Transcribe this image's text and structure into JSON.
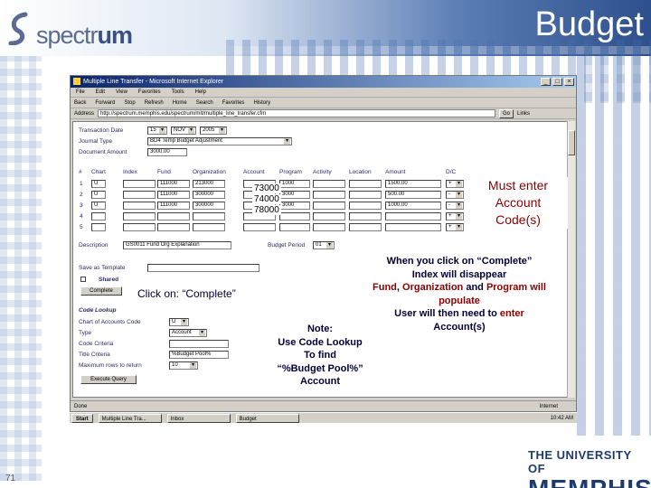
{
  "slide": {
    "title": "Budget",
    "logo": "spectrum",
    "logo_prefix": "spectr",
    "logo_suffix": "um",
    "number": "71",
    "university_top": "THE UNIVERSITY OF",
    "university_name": "MEMPHIS"
  },
  "browser": {
    "title": "Multiple Line Transfer - Microsoft Internet Explorer",
    "menu": [
      "File",
      "Edit",
      "View",
      "Favorites",
      "Tools",
      "Help"
    ],
    "toolbar": [
      "Back",
      "Forward",
      "Stop",
      "Refresh",
      "Home",
      "Search",
      "Favorites",
      "History"
    ],
    "address_label": "Address",
    "address_value": "http://spectrum.memphis.edu/spectrum/mlt/multiple_line_transfer.cfm",
    "go_label": "Go",
    "links_label": "Links",
    "status_text": "Done",
    "zone_text": "Internet",
    "start_label": "Start",
    "tasks": [
      "Multiple Line Tra...",
      "Inbox",
      "Budget"
    ],
    "clock": "10:42 AM"
  },
  "form": {
    "labels": {
      "transaction_date": "Transaction Date",
      "journal_type": "Journal Type",
      "document_amount": "Document Amount",
      "description": "Description",
      "budget_period": "Budget Period",
      "save_as_template": "Save as Template",
      "shared": "Shared",
      "complete": "Complete",
      "code_lookup": "Code Lookup",
      "chart_of_accounts_code": "Chart of Accounts Code",
      "type": "Type",
      "code_criteria": "Code Criteria",
      "title_criteria": "Title Criteria",
      "max_rows": "Maximum rows to return",
      "execute_query": "Execute Query"
    },
    "values": {
      "date_day": "15",
      "date_month": "NOV",
      "date_year": "2005",
      "journal_type": "BD4 Temp Budget Adjustment",
      "document_amount": "3000.00",
      "description": "GS0011 Fund Org Explanation",
      "budget_period": "01",
      "chart_code": "U",
      "lookup_type": "Account",
      "title_criteria": "%Budget Pool%",
      "max_rows": "10"
    },
    "grid": {
      "headers": [
        "#",
        "Chart",
        "Index",
        "Fund",
        "Organization",
        "Account",
        "Program",
        "Activity",
        "Location",
        "Amount",
        "D/C"
      ],
      "rows": [
        {
          "num": "1",
          "chart": "U",
          "fund": "111000",
          "org": "213000",
          "account": "",
          "program": "1000",
          "amount": "1500.00",
          "dc": "+"
        },
        {
          "num": "2",
          "chart": "U",
          "fund": "111000",
          "org": "300000",
          "account": "",
          "program": "3000",
          "amount": "500.00",
          "dc": "-"
        },
        {
          "num": "3",
          "chart": "U",
          "fund": "111000",
          "org": "300000",
          "account": "",
          "program": "3000",
          "amount": "1000.00",
          "dc": "-"
        },
        {
          "num": "4",
          "chart": "",
          "fund": "",
          "org": "",
          "account": "",
          "program": "",
          "amount": "",
          "dc": "+"
        },
        {
          "num": "5",
          "chart": "",
          "fund": "",
          "org": "",
          "account": "",
          "program": "",
          "amount": "",
          "dc": "+"
        }
      ],
      "account_overlays": [
        "73000",
        "74000",
        "78000"
      ]
    }
  },
  "callouts": {
    "must_enter": [
      "Must enter",
      "Account",
      "Code(s)"
    ],
    "click_on": "Click on: “Complete”",
    "note": [
      "Note:",
      "Use Code Lookup",
      "To find",
      "“%Budget Pool%”",
      "Account"
    ],
    "when_parts": {
      "p1": "When you click on “Complete”",
      "p2": "Index will disappear",
      "p3a": "Fund",
      "p3b": ", ",
      "p3c": "Organization",
      "p3d": " and ",
      "p3e": "Program will",
      "p4": "populate",
      "p5a": "User will then need to ",
      "p5b": "enter",
      "p6": "Account(s)"
    }
  },
  "colors": {
    "accent_red": "#8b0000",
    "navy_text": "#000035",
    "ie_title": "#0a246a"
  }
}
